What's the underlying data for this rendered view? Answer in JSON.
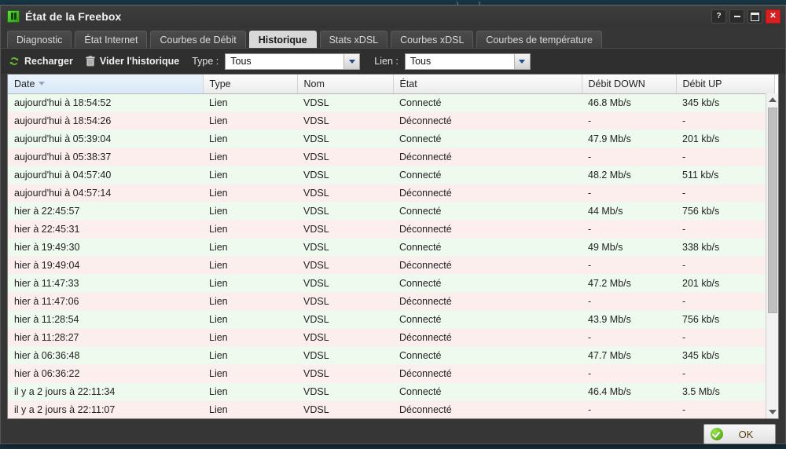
{
  "desktop": {
    "glyphs": ") . )"
  },
  "window": {
    "title": "État de la Freebox",
    "icon": "freebox-icon",
    "controls": [
      {
        "name": "help-button",
        "glyph": "?"
      },
      {
        "name": "minimize-button",
        "glyph": ""
      },
      {
        "name": "maximize-button",
        "glyph": ""
      },
      {
        "name": "close-button",
        "glyph": "✕"
      }
    ]
  },
  "tabs": [
    {
      "label": "Diagnostic",
      "active": false
    },
    {
      "label": "État Internet",
      "active": false
    },
    {
      "label": "Courbes de Débit",
      "active": false
    },
    {
      "label": "Historique",
      "active": true
    },
    {
      "label": "Stats xDSL",
      "active": false
    },
    {
      "label": "Courbes xDSL",
      "active": false
    },
    {
      "label": "Courbes de température",
      "active": false
    }
  ],
  "toolbar": {
    "reload_label": "Recharger",
    "clear_label": "Vider l'historique",
    "type_label": "Type :",
    "type_value": "Tous",
    "lien_label": "Lien :",
    "lien_value": "Tous"
  },
  "table": {
    "columns": [
      "Date",
      "Type",
      "Nom",
      "État",
      "Débit DOWN",
      "Débit UP"
    ],
    "sort_column": "Date",
    "sort_direction": "descending",
    "rows": [
      {
        "date": "aujourd'hui à 18:54:52",
        "type": "Lien",
        "nom": "VDSL",
        "etat": "Connecté",
        "down": "46.8 Mb/s",
        "up": "345 kb/s",
        "state": "ok"
      },
      {
        "date": "aujourd'hui à 18:54:26",
        "type": "Lien",
        "nom": "VDSL",
        "etat": "Déconnecté",
        "down": "-",
        "up": "-",
        "state": "fail"
      },
      {
        "date": "aujourd'hui à 05:39:04",
        "type": "Lien",
        "nom": "VDSL",
        "etat": "Connecté",
        "down": "47.9 Mb/s",
        "up": "201 kb/s",
        "state": "ok"
      },
      {
        "date": "aujourd'hui à 05:38:37",
        "type": "Lien",
        "nom": "VDSL",
        "etat": "Déconnecté",
        "down": "-",
        "up": "-",
        "state": "fail"
      },
      {
        "date": "aujourd'hui à 04:57:40",
        "type": "Lien",
        "nom": "VDSL",
        "etat": "Connecté",
        "down": "48.2 Mb/s",
        "up": "511 kb/s",
        "state": "ok"
      },
      {
        "date": "aujourd'hui à 04:57:14",
        "type": "Lien",
        "nom": "VDSL",
        "etat": "Déconnecté",
        "down": "-",
        "up": "-",
        "state": "fail"
      },
      {
        "date": "hier à 22:45:57",
        "type": "Lien",
        "nom": "VDSL",
        "etat": "Connecté",
        "down": "44 Mb/s",
        "up": "756 kb/s",
        "state": "ok"
      },
      {
        "date": "hier à 22:45:31",
        "type": "Lien",
        "nom": "VDSL",
        "etat": "Déconnecté",
        "down": "-",
        "up": "-",
        "state": "fail"
      },
      {
        "date": "hier à 19:49:30",
        "type": "Lien",
        "nom": "VDSL",
        "etat": "Connecté",
        "down": "49 Mb/s",
        "up": "338 kb/s",
        "state": "ok"
      },
      {
        "date": "hier à 19:49:04",
        "type": "Lien",
        "nom": "VDSL",
        "etat": "Déconnecté",
        "down": "-",
        "up": "-",
        "state": "fail"
      },
      {
        "date": "hier à 11:47:33",
        "type": "Lien",
        "nom": "VDSL",
        "etat": "Connecté",
        "down": "47.2 Mb/s",
        "up": "201 kb/s",
        "state": "ok"
      },
      {
        "date": "hier à 11:47:06",
        "type": "Lien",
        "nom": "VDSL",
        "etat": "Déconnecté",
        "down": "-",
        "up": "-",
        "state": "fail"
      },
      {
        "date": "hier à 11:28:54",
        "type": "Lien",
        "nom": "VDSL",
        "etat": "Connecté",
        "down": "43.9 Mb/s",
        "up": "756 kb/s",
        "state": "ok"
      },
      {
        "date": "hier à 11:28:27",
        "type": "Lien",
        "nom": "VDSL",
        "etat": "Déconnecté",
        "down": "-",
        "up": "-",
        "state": "fail"
      },
      {
        "date": "hier à 06:36:48",
        "type": "Lien",
        "nom": "VDSL",
        "etat": "Connecté",
        "down": "47.7 Mb/s",
        "up": "345 kb/s",
        "state": "ok"
      },
      {
        "date": "hier à 06:36:22",
        "type": "Lien",
        "nom": "VDSL",
        "etat": "Déconnecté",
        "down": "-",
        "up": "-",
        "state": "fail"
      },
      {
        "date": "il y a 2 jours à 22:11:34",
        "type": "Lien",
        "nom": "VDSL",
        "etat": "Connecté",
        "down": "46.4 Mb/s",
        "up": "3.5 Mb/s",
        "state": "ok"
      },
      {
        "date": "il y a 2 jours à 22:11:07",
        "type": "Lien",
        "nom": "VDSL",
        "etat": "Déconnecté",
        "down": "-",
        "up": "-",
        "state": "fail"
      }
    ]
  },
  "footer": {
    "ok_label": "OK"
  },
  "colors": {
    "accent_green": "#63b820",
    "close_red": "#d52121",
    "row_ok": "#eefaee",
    "row_fail": "#fdeeee",
    "sorted_header": "#d9e9f7"
  }
}
